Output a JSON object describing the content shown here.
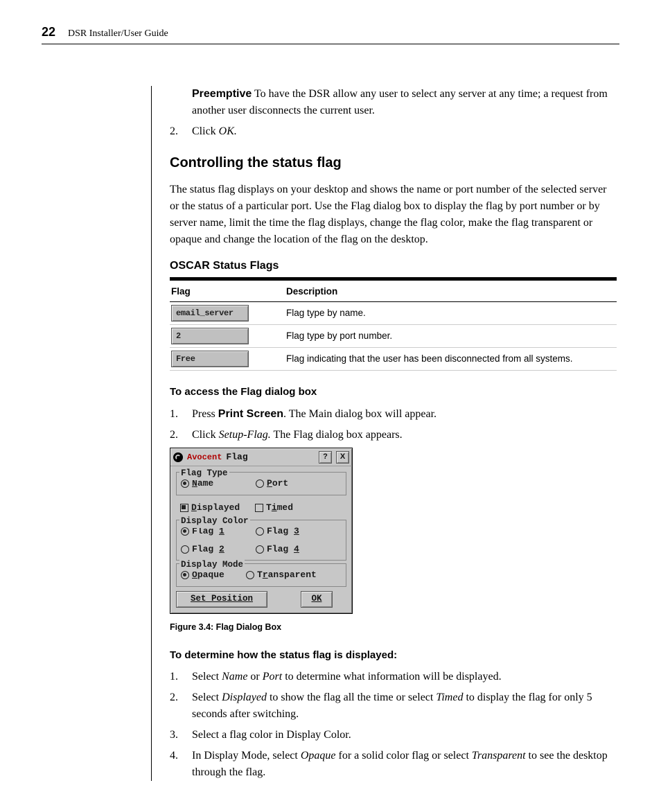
{
  "header": {
    "page_number": "22",
    "doc_title": "DSR Installer/User Guide"
  },
  "intro": {
    "bold_word": "Preemptive",
    "rest": " To have the DSR allow any user to select any server at any time; a request from another user disconnects the current user."
  },
  "step2": {
    "num": "2.",
    "pre": "Click ",
    "italic": "OK."
  },
  "section_heading": "Controlling the status flag",
  "section_para": "The status flag displays on your desktop and shows the name or port number of the selected server or the status of a particular port. Use the Flag dialog box to display the flag by port number or by server name, limit the time the flag displays, change the flag color, make the flag transparent or opaque and change the location of the flag on the desktop.",
  "table_title": "OSCAR Status Flags",
  "table": {
    "col1": "Flag",
    "col2": "Description",
    "rows": [
      {
        "flag": "email_server",
        "desc": "Flag type by name."
      },
      {
        "flag": "2",
        "desc": "Flag type by port number."
      },
      {
        "flag": "Free",
        "desc": "Flag indicating that the user has been disconnected from all systems."
      }
    ]
  },
  "access_heading": "To access the Flag dialog box",
  "access_steps": [
    {
      "num": "1.",
      "pre": "Press ",
      "bold": "Print Screen",
      "post": ". The Main dialog box will appear."
    },
    {
      "num": "2.",
      "pre": "Click ",
      "italic": "Setup-Flag.",
      "post": " The Flag dialog box appears."
    }
  ],
  "dialog": {
    "brand": "Avocent",
    "title": "Flag",
    "help": "?",
    "close": "X",
    "groups": {
      "flag_type": {
        "legend": "Flag Type",
        "name": "Name",
        "port": "Port"
      },
      "displayed": "Displayed",
      "timed": "Timed",
      "display_color": {
        "legend": "Display Color",
        "f1": "Flag 1",
        "f2": "Flag 2",
        "f3": "Flag 3",
        "f4": "Flag 4"
      },
      "display_mode": {
        "legend": "Display Mode",
        "opaque": "Opaque",
        "transparent": "Transparent"
      }
    },
    "buttons": {
      "set_position": "Set Position",
      "ok": "OK"
    }
  },
  "figure_caption": "Figure 3.4:  Flag Dialog Box",
  "determine_heading": "To determine how the status flag is displayed:",
  "determine_steps": [
    {
      "num": "1.",
      "pre": "Select ",
      "i1": "Name",
      "mid1": " or ",
      "i2": "Port",
      "post": " to determine what information will be displayed."
    },
    {
      "num": "2.",
      "pre": "Select ",
      "i1": "Displayed",
      "mid1": " to show the flag all the time or select ",
      "i2": "Timed",
      "post": " to display the flag for only 5 seconds after switching."
    },
    {
      "num": "3.",
      "plain": "Select a flag color in Display Color."
    },
    {
      "num": "4.",
      "pre": "In Display Mode, select ",
      "i1": "Opaque",
      "mid1": " for a solid color flag or select ",
      "i2": "Transparent",
      "post": " to see the desktop through the flag."
    }
  ]
}
